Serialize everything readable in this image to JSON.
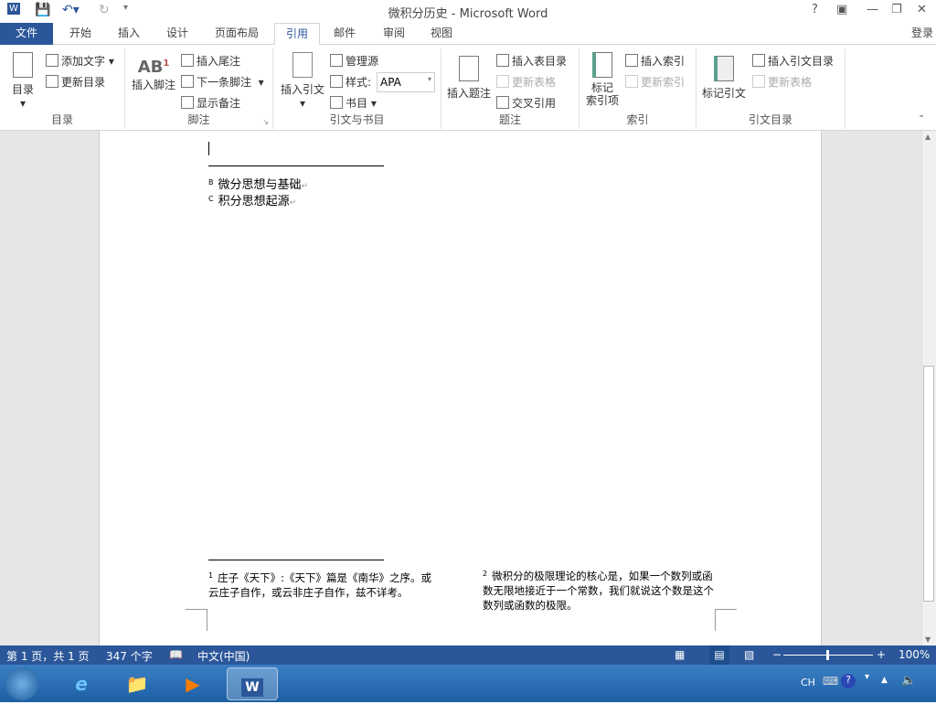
{
  "window": {
    "title": "微积分历史 - Microsoft Word",
    "help": "?",
    "signin": "登录"
  },
  "tabs": [
    "文件",
    "开始",
    "插入",
    "设计",
    "页面布局",
    "引用",
    "邮件",
    "审阅",
    "视图"
  ],
  "ribbon": {
    "toc": {
      "label": "目录",
      "big": "目录",
      "add_text": "添加文字",
      "update": "更新目录"
    },
    "footnotes": {
      "label": "脚注",
      "insert_footnote": "插入脚注",
      "insert_endnote": "插入尾注",
      "next_footnote": "下一条脚注",
      "show_notes": "显示备注"
    },
    "citations": {
      "label": "引文与书目",
      "insert_citation": "插入引文",
      "manage_sources": "管理源",
      "style_label": "样式:",
      "style_value": "APA",
      "bibliography": "书目"
    },
    "captions": {
      "label": "题注",
      "insert_caption": "插入题注",
      "insert_tof": "插入表目录",
      "update_table": "更新表格",
      "cross_ref": "交叉引用"
    },
    "index": {
      "label": "索引",
      "mark_entry": "标记\n索引项",
      "mark_entry_l1": "标记",
      "mark_entry_l2": "索引项",
      "insert_index": "插入索引",
      "update_index": "更新索引"
    },
    "toa": {
      "label": "引文目录",
      "mark_citation": "标记引文",
      "insert_toa": "插入引文目录",
      "update_table": "更新表格"
    }
  },
  "document": {
    "endnotes": [
      {
        "mark": "B",
        "text": "微分思想与基础"
      },
      {
        "mark": "C",
        "text": "积分思想起源"
      }
    ],
    "footnotes": [
      {
        "mark": "1",
        "text": "庄子《天下》:《天下》篇是《南华》之序。或云庄子自作，或云非庄子自作，兹不详考。"
      },
      {
        "mark": "2",
        "text": "微积分的极限理论的核心是，如果一个数列或函数无限地接近于一个常数，我们就说这个数是这个数列或函数的极限。"
      }
    ]
  },
  "status": {
    "page": "第 1 页，共 1 页",
    "words": "347 个字",
    "language": "中文(中国)",
    "zoom": "100%",
    "zoom_value": 100
  },
  "taskbar": {
    "ime": "CH"
  }
}
